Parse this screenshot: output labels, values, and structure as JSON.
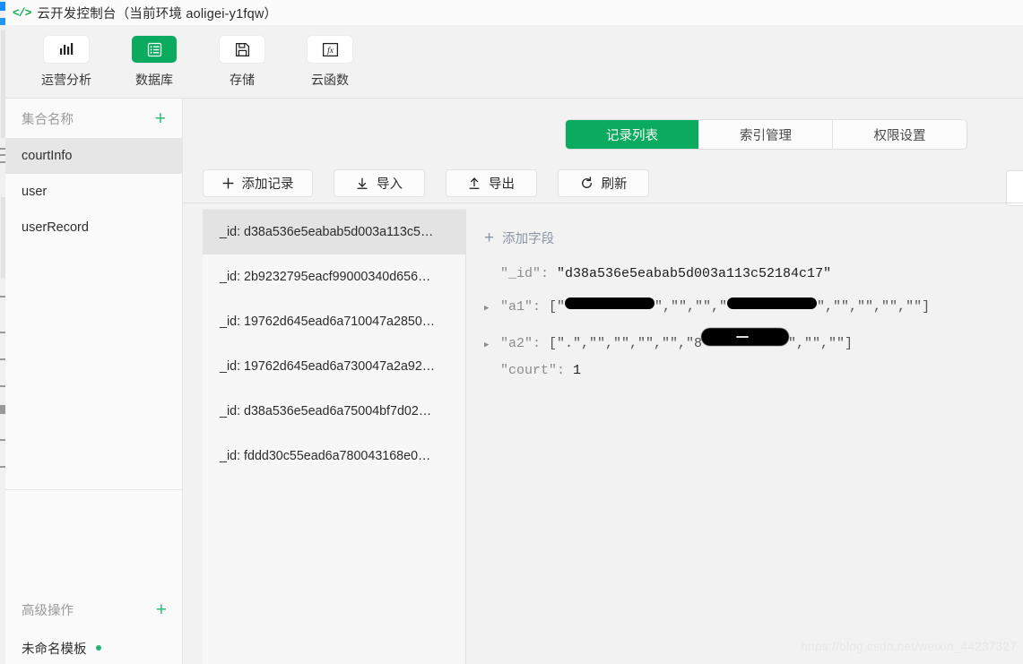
{
  "window": {
    "icon": "code-brackets-icon",
    "title": "云开发控制台（当前环境 aoligei-y1fqw）"
  },
  "nav": {
    "items": [
      {
        "label": "运营分析",
        "icon": "bar-chart-icon",
        "active": false
      },
      {
        "label": "数据库",
        "icon": "database-icon",
        "active": true
      },
      {
        "label": "存储",
        "icon": "floppy-disk-icon",
        "active": false
      },
      {
        "label": "云函数",
        "icon": "function-fx-icon",
        "active": false
      }
    ]
  },
  "sidebar": {
    "collections_header": "集合名称",
    "collections_add_label": "+",
    "collections": [
      {
        "label": "courtInfo",
        "selected": true
      },
      {
        "label": "user",
        "selected": false
      },
      {
        "label": "userRecord",
        "selected": false
      }
    ],
    "advanced_header": "高级操作",
    "advanced_add_label": "+",
    "advanced_items": [
      {
        "label": "未命名模板",
        "has_dot": true
      }
    ]
  },
  "tabs": [
    {
      "label": "记录列表",
      "active": true
    },
    {
      "label": "索引管理",
      "active": false
    },
    {
      "label": "权限设置",
      "active": false
    }
  ],
  "toolbar": [
    {
      "label": "添加记录",
      "icon": "plus-icon"
    },
    {
      "label": "导入",
      "icon": "download-icon"
    },
    {
      "label": "导出",
      "icon": "upload-icon"
    },
    {
      "label": "刷新",
      "icon": "refresh-icon"
    }
  ],
  "records": [
    {
      "label": "_id: d38a536e5eabab5d003a113c5…",
      "selected": true
    },
    {
      "label": "_id: 2b9232795eacf99000340d656…",
      "selected": false
    },
    {
      "label": "_id: 19762d645ead6a710047a2850…",
      "selected": false
    },
    {
      "label": "_id: 19762d645ead6a730047a2a92…",
      "selected": false
    },
    {
      "label": "_id: d38a536e5ead6a75004bf7d02…",
      "selected": false
    },
    {
      "label": "_id: fddd30c55ead6a780043168e0…",
      "selected": false
    }
  ],
  "detail": {
    "add_field_label": "添加字段",
    "rows": [
      {
        "expandable": false,
        "key": "\"_id\":",
        "value_text": "\"d38a536e5eabab5d003a113c52184c17\""
      },
      {
        "expandable": true,
        "key": "\"a1\":",
        "value_prefix": "[\"",
        "value_middle_1": "\",\"\",\"\",\"",
        "value_suffix": "\",\"\",\"\",\"\",\"\"]",
        "redaction_1_width": 100,
        "redaction_2_width": 100
      },
      {
        "expandable": true,
        "key": "\"a2\":",
        "value_prefix": "[\".\",\"\",\"\",\"\",\"\",\"8",
        "value_suffix": "\",\"\",\"\"]",
        "redaction_1_width": 96
      },
      {
        "expandable": false,
        "key": "\"court\":",
        "value_text": "1"
      }
    ]
  },
  "watermark": "https://blog.csdn.net/weixin_44237327",
  "colors": {
    "brand_green": "#0bab5f",
    "accent_green": "#2fbf73",
    "title_icon_green": "#1aad52",
    "selected_gray": "#e3e3e3",
    "panel_gray": "#f2f2f2",
    "watermark_gray": "#e7e7e7"
  }
}
